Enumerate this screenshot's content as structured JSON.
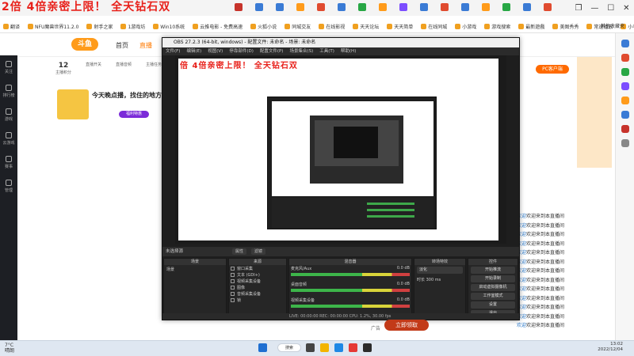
{
  "promo_banner": "2倍 4倍亲密上限！ 全天钻石双",
  "window_controls": {
    "restore": "❐",
    "minimize": "—",
    "maximize": "☐",
    "close": "✕"
  },
  "bookmarks": [
    "翻译",
    "NFU魔兽世界11.2.0",
    "射手之家",
    "1游戏坊",
    "Win10系统",
    "云推电影 - 免费高速",
    "火狐小说",
    "同城交友",
    "在线影视",
    "天天论坛",
    "天天简单",
    "在线同城",
    "小游戏",
    "游戏搜索",
    "最新遊戲",
    "美图秀秀",
    "常速播放",
    "小马美游",
    "热点之家"
  ],
  "bookmarks_right": "其他收藏夹",
  "site": {
    "logo": "斗鱼",
    "nav": [
      "首页",
      "直播"
    ],
    "stats": [
      {
        "n": "12",
        "label": "主播积分"
      },
      {
        "n": "",
        "label": "直播开关"
      },
      {
        "n": "",
        "label": "直播音频"
      },
      {
        "n": "",
        "label": "主播任务"
      }
    ],
    "headline": "今天晚点播，找住的地方",
    "pc_button": "PC客户端",
    "hot_button": "福利特惠"
  },
  "left_rail": [
    "关注",
    "排行榜",
    "游戏",
    "云游戏",
    "赛事",
    "管理"
  ],
  "obs": {
    "title": "OBS 27.2.3 (64-bit, windows) - 配置文件: 未命名 - 场景: 未命名",
    "menu": [
      "文件(F)",
      "编辑(E)",
      "视图(V)",
      "停靠部件(D)",
      "配置文件(P)",
      "场景集合(S)",
      "工具(T)",
      "帮助(H)"
    ],
    "source_bar": "未选择源",
    "props_button": "属性",
    "filters_button": "滤镜",
    "docks": {
      "scenes": {
        "title": "场景",
        "items": [
          "场景"
        ]
      },
      "sources": {
        "title": "来源",
        "items": [
          "窗口采集",
          "文本 (GDI+)",
          "视频采集设备",
          "图像",
          "音频采集设备",
          "锁"
        ]
      },
      "mixer": {
        "title": "混音器",
        "tracks": [
          {
            "name": "麦克风/Aux",
            "db": "0.0 dB"
          },
          {
            "name": "桌面音频",
            "db": "0.0 dB"
          },
          {
            "name": "视频采集设备",
            "db": "0.0 dB"
          }
        ]
      },
      "transitions": {
        "title": "转场特效",
        "type": "淡化",
        "duration_label": "时长",
        "duration": "300 ms"
      },
      "controls": {
        "title": "控件",
        "buttons": [
          "开始推流",
          "开始录制",
          "启动虚拟摄像机",
          "工作室模式",
          "设置",
          "退出"
        ]
      }
    },
    "status": "LIVE: 00:00:00   REC: 00:00:00   CPU: 1.2%, 30.00 fps"
  },
  "nested_promo": "倍 4倍亲密上限！ 全天钻石双",
  "chat": [
    {
      "user": "欢迎",
      "text": "欢迎来到本直播间"
    },
    {
      "user": "欢迎",
      "text": "欢迎来到本直播间"
    },
    {
      "user": "欢迎",
      "text": "欢迎来到本直播间"
    },
    {
      "user": "欢迎",
      "text": "欢迎来到本直播间"
    },
    {
      "user": "欢迎",
      "text": "欢迎来到本直播间"
    },
    {
      "user": "欢迎",
      "text": "欢迎来到本直播间"
    },
    {
      "user": "欢迎",
      "text": "欢迎来到本直播间"
    },
    {
      "user": "欢迎",
      "text": "欢迎来到本直播间"
    },
    {
      "user": "欢迎",
      "text": "欢迎来到本直播间"
    },
    {
      "user": "欢迎",
      "text": "欢迎来到本直播间"
    },
    {
      "user": "欢迎",
      "text": "欢迎来到本直播间"
    },
    {
      "user": "欢迎",
      "text": "欢迎来到本直播间"
    },
    {
      "user": "欢迎",
      "text": "欢迎来到本直播间"
    }
  ],
  "big_button": "立即领取",
  "ad_label": "广告",
  "taskbar": {
    "weather_temp": "7°C",
    "weather_desc": "晴朗",
    "search": "搜索",
    "time": "13:02",
    "date": "2022/12/04"
  }
}
